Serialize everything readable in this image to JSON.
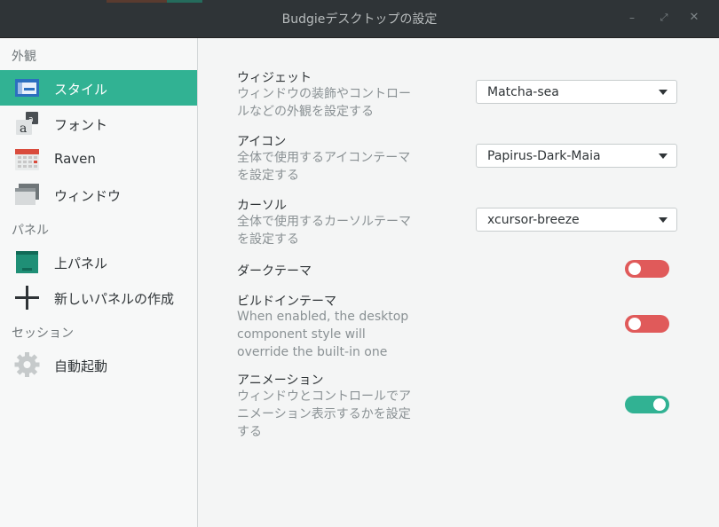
{
  "window": {
    "title": "Budgieデスクトップの設定"
  },
  "sidebar": {
    "sections": [
      "外観",
      "パネル",
      "セッション"
    ],
    "items": [
      {
        "label": "スタイル",
        "icon": "style-icon",
        "active": true
      },
      {
        "label": "フォント",
        "icon": "font-icon",
        "active": false
      },
      {
        "label": "Raven",
        "icon": "raven-calendar-icon",
        "active": false
      },
      {
        "label": "ウィンドウ",
        "icon": "window-icon",
        "active": false
      },
      {
        "label": "上パネル",
        "icon": "panel-icon",
        "active": false
      },
      {
        "label": "新しいパネルの作成",
        "icon": "plus-icon",
        "active": false
      },
      {
        "label": "自動起動",
        "icon": "gear-icon",
        "active": false
      }
    ]
  },
  "settings": {
    "widget": {
      "title": "ウィジェット",
      "desc": "ウィンドウの装飾やコントロールなどの外観を設定する",
      "value": "Matcha-sea"
    },
    "icons": {
      "title": "アイコン",
      "desc": "全体で使用するアイコンテーマを設定する",
      "value": "Papirus-Dark-Maia"
    },
    "cursor": {
      "title": "カーソル",
      "desc": "全体で使用するカーソルテーマを設定する",
      "value": "xcursor-breeze"
    },
    "dark_theme": {
      "title": "ダークテーマ",
      "enabled": false
    },
    "builtin_theme": {
      "title": "ビルドインテーマ",
      "desc": "When enabled, the desktop component style will override the built-in one",
      "enabled": false
    },
    "animations": {
      "title": "アニメーション",
      "desc": "ウィンドウとコントロールでアニメーション表示するかを設定する",
      "enabled": true
    }
  },
  "colors": {
    "accent": "#31b293",
    "toggle_off": "#e05a5a",
    "toggle_on": "#31b293"
  }
}
